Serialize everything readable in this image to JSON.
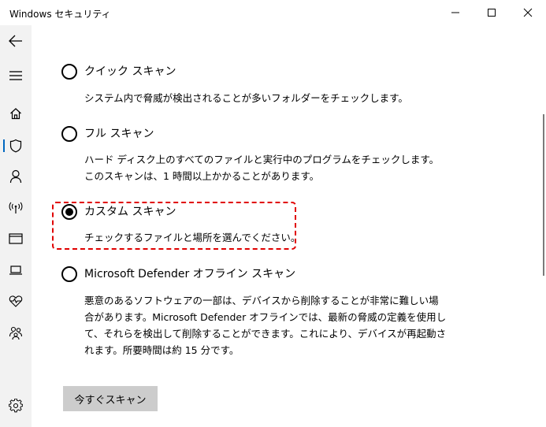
{
  "window": {
    "title": "Windows セキュリティ"
  },
  "sidebar": {
    "items": [
      {
        "icon": "back-arrow-icon"
      },
      {
        "icon": "hamburger-menu-icon"
      },
      {
        "icon": "home-icon"
      },
      {
        "icon": "shield-icon",
        "active": true
      },
      {
        "icon": "person-icon"
      },
      {
        "icon": "wireless-antenna-icon"
      },
      {
        "icon": "app-browser-window-icon"
      },
      {
        "icon": "laptop-icon"
      },
      {
        "icon": "heart-pulse-icon"
      },
      {
        "icon": "family-icon"
      },
      {
        "icon": "gear-icon"
      }
    ]
  },
  "scan_options": [
    {
      "label": "クイック スキャン",
      "description": "システム内で脅威が検出されることが多いフォルダーをチェックします。",
      "selected": false
    },
    {
      "label": "フル スキャン",
      "description": "ハード ディスク上のすべてのファイルと実行中のプログラムをチェックします。このスキャンは、1 時間以上かかることがあります。",
      "selected": false
    },
    {
      "label": "カスタム スキャン",
      "description": "チェックするファイルと場所を選んでください。",
      "selected": true
    },
    {
      "label": "Microsoft Defender オフライン スキャン",
      "description": "悪意のあるソフトウェアの一部は、デバイスから削除することが非常に難しい場合があります。Microsoft Defender オフラインでは、最新の脅威の定義を使用して、それらを検出して削除することができます。これにより、デバイスが再起動されます。所要時間は約 15 分です。",
      "selected": false
    }
  ],
  "actions": {
    "scan_now_label": "今すぐスキャン"
  },
  "colors": {
    "accent": "#0067c0",
    "highlight_border": "#e00000",
    "button_bg": "#cccccc",
    "sidebar_bg": "#f2f2f2"
  }
}
